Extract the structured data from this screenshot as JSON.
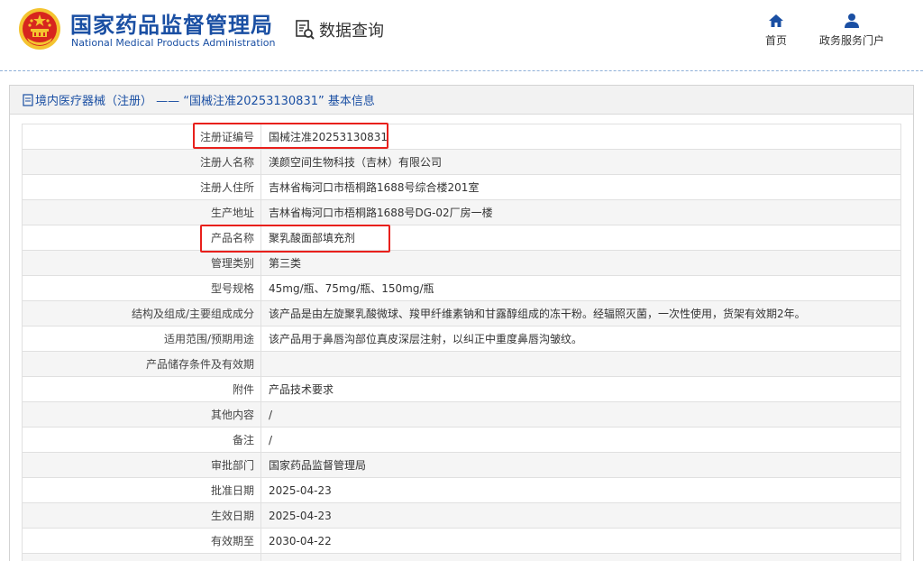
{
  "header": {
    "brand_cn": "国家药品监督管理局",
    "brand_en": "National Medical Products Administration",
    "query_label": "数据查询",
    "nav": [
      {
        "label": "首页",
        "icon": "home-icon"
      },
      {
        "label": "政务服务门户",
        "icon": "user-icon"
      }
    ]
  },
  "panel": {
    "title": "境内医疗器械（注册） —— “国械注准20253130831” 基本信息"
  },
  "rows": [
    {
      "label": "注册证编号",
      "value": "国械注准20253130831"
    },
    {
      "label": "注册人名称",
      "value": "渼颜空间生物科技（吉林）有限公司"
    },
    {
      "label": "注册人住所",
      "value": "吉林省梅河口市梧桐路1688号综合楼201室"
    },
    {
      "label": "生产地址",
      "value": "吉林省梅河口市梧桐路1688号DG-02厂房一楼"
    },
    {
      "label": "产品名称",
      "value": "聚乳酸面部填充剂"
    },
    {
      "label": "管理类别",
      "value": "第三类"
    },
    {
      "label": "型号规格",
      "value": "45mg/瓶、75mg/瓶、150mg/瓶"
    },
    {
      "label": "结构及组成/主要组成成分",
      "value": "该产品是由左旋聚乳酸微球、羧甲纤维素钠和甘露醇组成的冻干粉。经辐照灭菌，一次性使用，货架有效期2年。"
    },
    {
      "label": "适用范围/预期用途",
      "value": "该产品用于鼻唇沟部位真皮深层注射，以纠正中重度鼻唇沟皱纹。"
    },
    {
      "label": "产品储存条件及有效期",
      "value": ""
    },
    {
      "label": "附件",
      "value": "产品技术要求"
    },
    {
      "label": "其他内容",
      "value": "/"
    },
    {
      "label": "备注",
      "value": "/"
    },
    {
      "label": "审批部门",
      "value": "国家药品监督管理局"
    },
    {
      "label": "批准日期",
      "value": "2025-04-23"
    },
    {
      "label": "生效日期",
      "value": "2025-04-23"
    },
    {
      "label": "有效期至",
      "value": "2030-04-22"
    },
    {
      "label": "",
      "value": ""
    }
  ],
  "colors": {
    "brand_blue": "#1a4fa3",
    "highlight_red": "#e8201c",
    "emblem_red": "#d7261e",
    "emblem_gold": "#f4c430"
  }
}
